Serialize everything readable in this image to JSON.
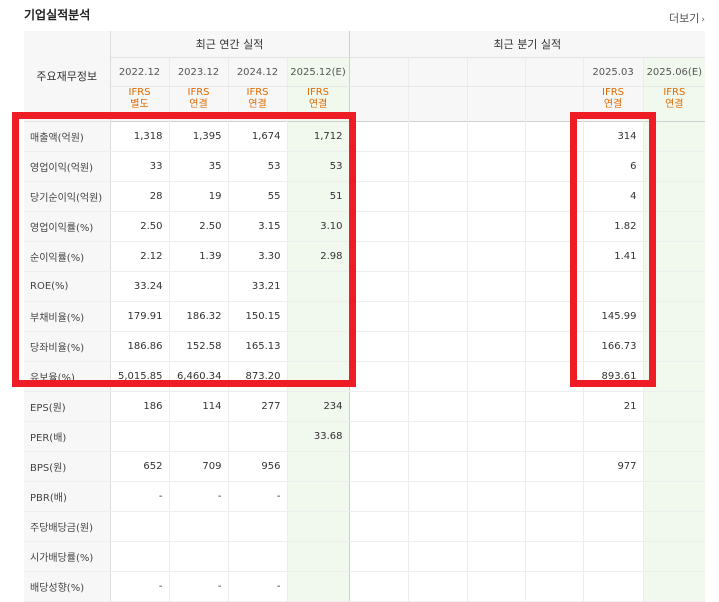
{
  "section_title": "기업실적분석",
  "more_label": "더보기",
  "header": {
    "label": "주요재무정보",
    "annual_group": "최근 연간 실적",
    "quarter_group": "최근 분기 실적",
    "annual_periods": [
      "2022.12",
      "2023.12",
      "2024.12",
      "2025.12(E)"
    ],
    "quarter_periods": [
      "",
      "",
      "",
      "",
      "2025.03",
      "2025.06(E)"
    ],
    "annual_standards": [
      {
        "l1": "IFRS",
        "l2": "별도"
      },
      {
        "l1": "IFRS",
        "l2": "연결"
      },
      {
        "l1": "IFRS",
        "l2": "연결"
      },
      {
        "l1": "IFRS",
        "l2": "연결"
      }
    ],
    "quarter_standards": [
      {
        "l1": "",
        "l2": ""
      },
      {
        "l1": "",
        "l2": ""
      },
      {
        "l1": "",
        "l2": ""
      },
      {
        "l1": "",
        "l2": ""
      },
      {
        "l1": "IFRS",
        "l2": "연결"
      },
      {
        "l1": "IFRS",
        "l2": "연결"
      }
    ]
  },
  "rows": [
    {
      "label": "매출액(억원)",
      "annual": [
        "1,318",
        "1,395",
        "1,674",
        "1,712"
      ],
      "quarter": [
        "",
        "",
        "",
        "",
        "314",
        ""
      ]
    },
    {
      "label": "영업이익(억원)",
      "annual": [
        "33",
        "35",
        "53",
        "53"
      ],
      "quarter": [
        "",
        "",
        "",
        "",
        "6",
        ""
      ]
    },
    {
      "label": "당기순이익(억원)",
      "annual": [
        "28",
        "19",
        "55",
        "51"
      ],
      "quarter": [
        "",
        "",
        "",
        "",
        "4",
        ""
      ]
    },
    {
      "label": "영업이익률(%)",
      "annual": [
        "2.50",
        "2.50",
        "3.15",
        "3.10"
      ],
      "quarter": [
        "",
        "",
        "",
        "",
        "1.82",
        ""
      ]
    },
    {
      "label": "순이익률(%)",
      "annual": [
        "2.12",
        "1.39",
        "3.30",
        "2.98"
      ],
      "quarter": [
        "",
        "",
        "",
        "",
        "1.41",
        ""
      ]
    },
    {
      "label": "ROE(%)",
      "annual": [
        "33.24",
        "",
        "33.21",
        ""
      ],
      "quarter": [
        "",
        "",
        "",
        "",
        "",
        ""
      ]
    },
    {
      "label": "부채비율(%)",
      "annual": [
        "179.91",
        "186.32",
        "150.15",
        ""
      ],
      "quarter": [
        "",
        "",
        "",
        "",
        "145.99",
        ""
      ]
    },
    {
      "label": "당좌비율(%)",
      "annual": [
        "186.86",
        "152.58",
        "165.13",
        ""
      ],
      "quarter": [
        "",
        "",
        "",
        "",
        "166.73",
        ""
      ]
    },
    {
      "label": "유보율(%)",
      "annual": [
        "5,015.85",
        "6,460.34",
        "873.20",
        ""
      ],
      "quarter": [
        "",
        "",
        "",
        "",
        "893.61",
        ""
      ]
    },
    {
      "label": "EPS(원)",
      "annual": [
        "186",
        "114",
        "277",
        "234"
      ],
      "quarter": [
        "",
        "",
        "",
        "",
        "21",
        ""
      ]
    },
    {
      "label": "PER(배)",
      "annual": [
        "",
        "",
        "",
        "33.68"
      ],
      "quarter": [
        "",
        "",
        "",
        "",
        "",
        ""
      ]
    },
    {
      "label": "BPS(원)",
      "annual": [
        "652",
        "709",
        "956",
        ""
      ],
      "quarter": [
        "",
        "",
        "",
        "",
        "977",
        ""
      ]
    },
    {
      "label": "PBR(배)",
      "annual": [
        "-",
        "-",
        "-",
        ""
      ],
      "quarter": [
        "",
        "",
        "",
        "",
        "",
        ""
      ]
    },
    {
      "label": "주당배당금(원)",
      "annual": [
        "",
        "",
        "",
        ""
      ],
      "quarter": [
        "",
        "",
        "",
        "",
        "",
        ""
      ]
    },
    {
      "label": "시가배당률(%)",
      "annual": [
        "",
        "",
        "",
        ""
      ],
      "quarter": [
        "",
        "",
        "",
        "",
        "",
        ""
      ]
    },
    {
      "label": "배당성향(%)",
      "annual": [
        "-",
        "-",
        "-",
        ""
      ],
      "quarter": [
        "",
        "",
        "",
        "",
        "",
        ""
      ]
    }
  ],
  "highlight_color": "#ee1c25"
}
